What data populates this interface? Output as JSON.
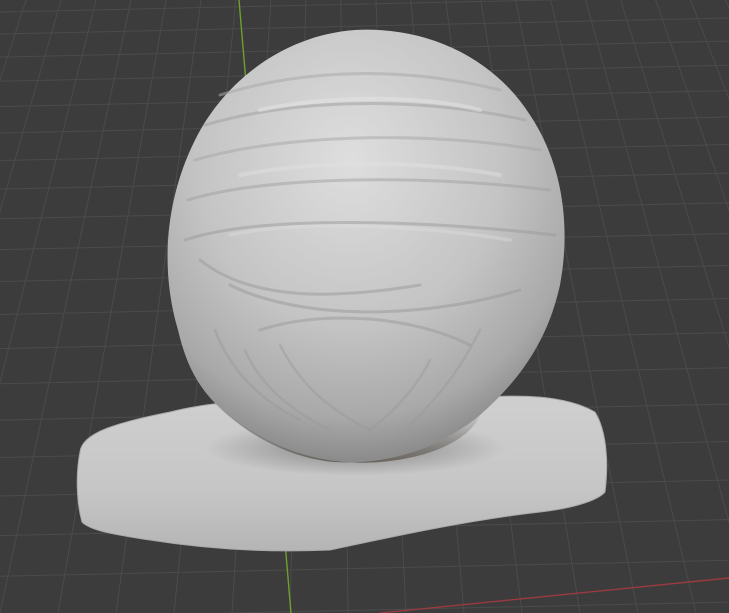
{
  "viewport": {
    "background": "#3c3c3c",
    "grid_line_color": "#4b4b4b",
    "axis_y_color": "#6f9f2d",
    "axis_x_color": "#9b3a3f"
  },
  "model": {
    "kind": "sculpted-head-bust-back-view",
    "base_color": "#c3c3c3",
    "shadow_color": "#6a6a6a",
    "highlight_color": "#e3e3e3"
  }
}
